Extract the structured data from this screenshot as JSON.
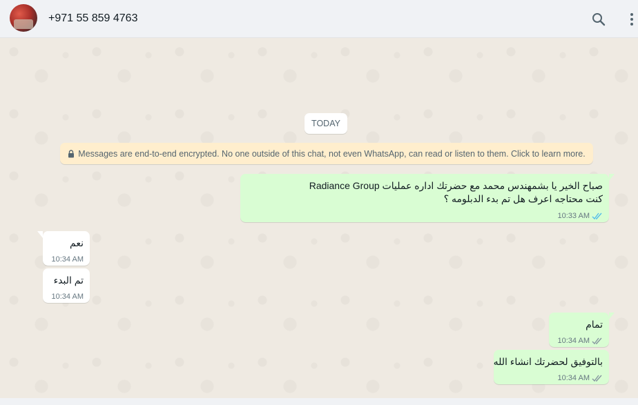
{
  "header": {
    "contact_name": "+971 55 859 4763",
    "icons": [
      "avatar",
      "search-icon",
      "menu-icon"
    ]
  },
  "chat": {
    "date_label": "TODAY",
    "encryption_notice": "Messages are end-to-end encrypted. No one outside of this chat, not even WhatsApp, can read or listen to them. Click to learn more.",
    "messages": [
      {
        "direction": "out",
        "lines": [
          "صباح الخير يا بشمهندس محمد مع حضرتك اداره عمليات Radiance Group",
          "كنت محتاجه اعرف هل تم بدء الدبلومه ؟"
        ],
        "time": "10:33 AM",
        "status": "read"
      },
      {
        "direction": "in",
        "lines": [
          "نعم"
        ],
        "time": "10:34 AM"
      },
      {
        "direction": "in",
        "lines": [
          "تم البدء"
        ],
        "time": "10:34 AM"
      },
      {
        "direction": "out",
        "lines": [
          "تمام"
        ],
        "time": "10:34 AM",
        "status": "delivered"
      },
      {
        "direction": "out",
        "lines": [
          "بالتوفيق لحضرتك انشاء الله"
        ],
        "time": "10:34 AM",
        "status": "delivered"
      }
    ]
  },
  "colors": {
    "header_bg": "#f0f2f5",
    "chat_bg": "#efeae2",
    "outgoing_bubble": "#d9fdd3",
    "incoming_bubble": "#ffffff",
    "notice_bg": "#ffeecd",
    "read_ticks": "#53bdeb",
    "delivered_ticks": "#8696a0"
  }
}
